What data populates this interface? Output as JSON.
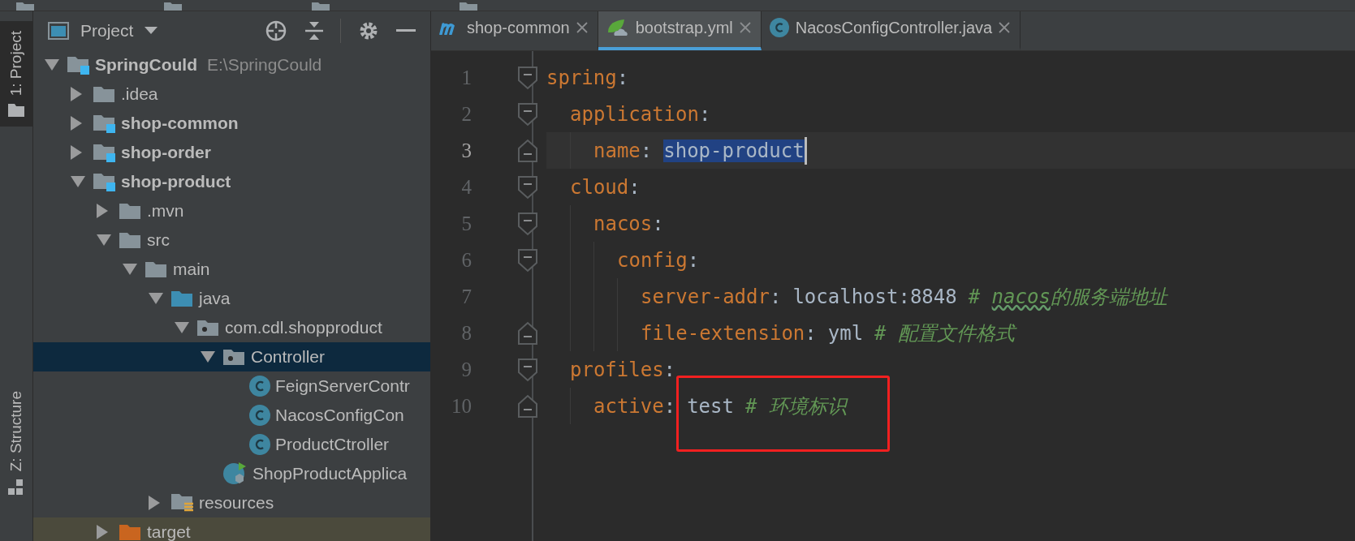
{
  "tool_window_strip": [
    {
      "label": "1: Project",
      "kind": "project",
      "selected": true
    },
    {
      "label": "Z: Structure",
      "kind": "structure",
      "selected": false
    }
  ],
  "project_panel": {
    "title": "Project",
    "tree": [
      {
        "label": "SpringCould",
        "hint": "E:\\SpringCould",
        "kind": "module",
        "expanded": true,
        "selected": false,
        "children": [
          {
            "label": ".idea",
            "kind": "folder",
            "expanded": false,
            "selected": false
          },
          {
            "label": "shop-common",
            "kind": "module",
            "expanded": false,
            "selected": false
          },
          {
            "label": "shop-order",
            "kind": "module",
            "expanded": false,
            "selected": false
          },
          {
            "label": "shop-product",
            "kind": "module",
            "expanded": true,
            "selected": false,
            "children": [
              {
                "label": ".mvn",
                "kind": "folder",
                "expanded": false,
                "selected": false
              },
              {
                "label": "src",
                "kind": "folder",
                "expanded": true,
                "selected": false,
                "children": [
                  {
                    "label": "main",
                    "kind": "folder",
                    "expanded": true,
                    "selected": false,
                    "children": [
                      {
                        "label": "java",
                        "kind": "source_folder",
                        "expanded": true,
                        "selected": false,
                        "children": [
                          {
                            "label": "com.cdl.shopproduct",
                            "kind": "package",
                            "expanded": true,
                            "selected": false,
                            "children": [
                              {
                                "label": "Controller",
                                "kind": "package",
                                "expanded": true,
                                "selected": true,
                                "children": [
                                  {
                                    "label": "FeignServerContr",
                                    "kind": "class",
                                    "selected": false
                                  },
                                  {
                                    "label": "NacosConfigCon",
                                    "kind": "class",
                                    "selected": false
                                  },
                                  {
                                    "label": "ProductCtroller",
                                    "kind": "class",
                                    "selected": false
                                  }
                                ]
                              },
                              {
                                "label": "ShopProductApplica",
                                "kind": "app_class",
                                "selected": false
                              }
                            ]
                          }
                        ]
                      },
                      {
                        "label": "resources",
                        "kind": "resources",
                        "expanded": false,
                        "selected": false
                      }
                    ]
                  }
                ]
              },
              {
                "label": "target",
                "kind": "excluded",
                "expanded": false,
                "selected": false
              }
            ]
          }
        ]
      }
    ]
  },
  "editor_tabs": [
    {
      "label": "shop-common",
      "kind": "maven",
      "selected": false
    },
    {
      "label": "bootstrap.yml",
      "kind": "yaml",
      "selected": true
    },
    {
      "label": "NacosConfigController.java",
      "kind": "class",
      "selected": false
    }
  ],
  "code": [
    {
      "number": "1",
      "current": false,
      "tokens": [
        {
          "kind": "key",
          "text": "spring"
        },
        {
          "kind": "punct",
          "text": ":"
        }
      ],
      "children": [
        {
          "number": "2",
          "current": false,
          "tokens": [
            {
              "kind": "key",
              "text": "application"
            },
            {
              "kind": "punct",
              "text": ":"
            }
          ],
          "children": [
            {
              "number": "3",
              "current": true,
              "tokens": [
                {
                  "kind": "key",
                  "text": "name"
                },
                {
                  "kind": "punct",
                  "text": ":"
                },
                {
                  "kind": "value",
                  "text": "shop-product",
                  "selected": true
                }
              ]
            }
          ]
        },
        {
          "number": "4",
          "current": false,
          "tokens": [
            {
              "kind": "key",
              "text": "cloud"
            },
            {
              "kind": "punct",
              "text": ":"
            }
          ],
          "children": [
            {
              "number": "5",
              "current": false,
              "tokens": [
                {
                  "kind": "key",
                  "text": "nacos"
                },
                {
                  "kind": "punct",
                  "text": ":"
                }
              ],
              "children": [
                {
                  "number": "6",
                  "current": false,
                  "tokens": [
                    {
                      "kind": "key",
                      "text": "config"
                    },
                    {
                      "kind": "punct",
                      "text": ":"
                    }
                  ],
                  "children": [
                    {
                      "number": "7",
                      "current": false,
                      "tokens": [
                        {
                          "kind": "key",
                          "text": "server-addr"
                        },
                        {
                          "kind": "punct",
                          "text": ":"
                        },
                        {
                          "kind": "value",
                          "text": "localhost:8848",
                          "selected": false
                        },
                        {
                          "kind": "comment",
                          "parts": [
                            {
                              "text": "# ",
                              "typo": false
                            },
                            {
                              "text": "nacos",
                              "typo": true
                            },
                            {
                              "text": "的服务端地址",
                              "typo": false
                            }
                          ]
                        }
                      ]
                    },
                    {
                      "number": "8",
                      "current": false,
                      "tokens": [
                        {
                          "kind": "key",
                          "text": "file-extension"
                        },
                        {
                          "kind": "punct",
                          "text": ":"
                        },
                        {
                          "kind": "value",
                          "text": "yml",
                          "selected": false
                        },
                        {
                          "kind": "comment",
                          "parts": [
                            {
                              "text": "# 配置文件格式",
                              "typo": false
                            }
                          ]
                        }
                      ]
                    }
                  ]
                }
              ]
            }
          ]
        },
        {
          "number": "9",
          "current": false,
          "tokens": [
            {
              "kind": "key",
              "text": "profiles"
            },
            {
              "kind": "punct",
              "text": ":"
            }
          ],
          "children": [
            {
              "number": "10",
              "current": false,
              "tokens": [
                {
                  "kind": "key",
                  "text": "active"
                },
                {
                  "kind": "punct",
                  "text": ":"
                },
                {
                  "kind": "value",
                  "text": "test",
                  "selected": false
                },
                {
                  "kind": "comment",
                  "parts": [
                    {
                      "text": "# 环境标识",
                      "typo": false
                    }
                  ]
                }
              ]
            }
          ]
        }
      ]
    }
  ]
}
